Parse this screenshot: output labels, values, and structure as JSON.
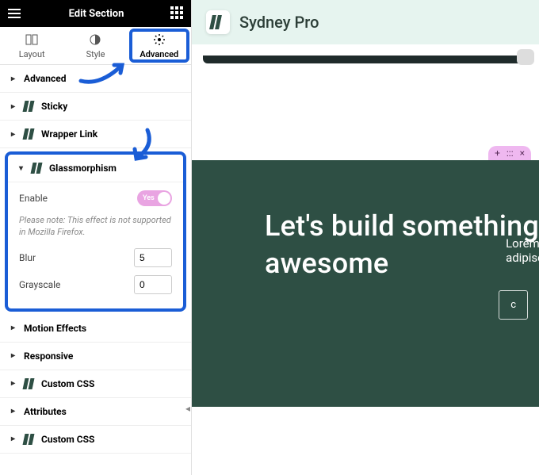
{
  "panel": {
    "header_title": "Edit Section",
    "tabs": [
      {
        "label": "Layout"
      },
      {
        "label": "Style"
      },
      {
        "label": "Advanced"
      }
    ],
    "sections": {
      "advanced": "Advanced",
      "sticky": "Sticky",
      "wrapper_link": "Wrapper Link",
      "glassmorphism": "Glassmorphism",
      "motion_effects": "Motion Effects",
      "responsive": "Responsive",
      "custom_css_1": "Custom CSS",
      "attributes": "Attributes",
      "custom_css_2": "Custom CSS"
    },
    "glass": {
      "enable_label": "Enable",
      "enable_state": "Yes",
      "note": "Please note: This effect is not supported in Mozilla Firefox.",
      "blur_label": "Blur",
      "blur_value": "5",
      "grayscale_label": "Grayscale",
      "grayscale_value": "0"
    }
  },
  "preview": {
    "brand": "Sydney Pro",
    "section_tools": {
      "add": "+",
      "drag": ":::",
      "close": "×"
    },
    "hero_heading": "Let's build something awesome",
    "hero_text1": "Lorem",
    "hero_text2": "adipisc",
    "cta": "c"
  }
}
